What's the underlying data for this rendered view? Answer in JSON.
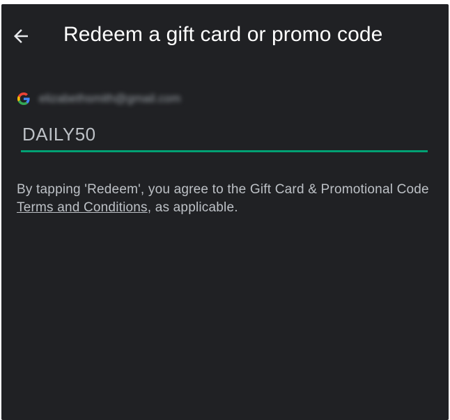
{
  "header": {
    "back_icon": "arrow-back-icon",
    "title": "Redeem a gift card or promo code"
  },
  "account": {
    "logo_icon": "google-g-icon",
    "email": "elizabethsmith@gmail.com"
  },
  "code_field": {
    "value": "DAILY50"
  },
  "terms": {
    "before_link": "By tapping 'Redeem', you agree to the Gift Card & Promotional Code ",
    "link_text": "Terms and Conditions",
    "after_link": ", as applicable."
  },
  "colors": {
    "background": "#202124",
    "accent": "#00a173",
    "title_text": "#ffffff",
    "body_text": "#bdc1c6"
  }
}
